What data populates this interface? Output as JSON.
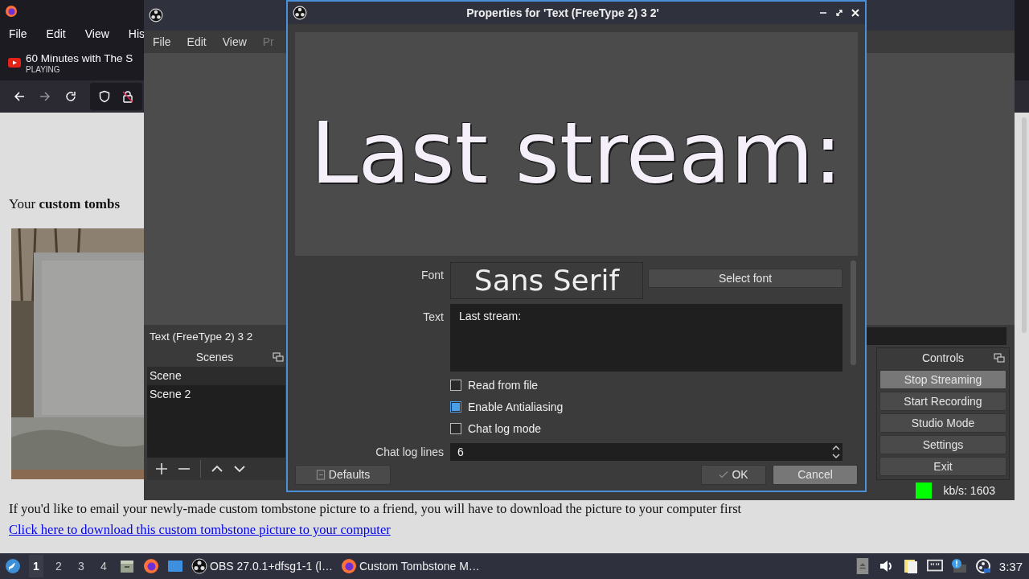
{
  "browser": {
    "menu": [
      "File",
      "Edit",
      "View",
      "His"
    ],
    "tab": {
      "title": "60 Minutes with The S",
      "status": "PLAYING"
    },
    "page": {
      "heading": "Your **custom tombs**",
      "paragraph": "If you'd like to email your newly-made custom tombstone picture to a friend, you will have to download the picture to your computer first",
      "link": "Click here to download this custom tombstone picture to your computer"
    }
  },
  "obs": {
    "menu": [
      {
        "label": "File",
        "disabled": false
      },
      {
        "label": "Edit",
        "disabled": false
      },
      {
        "label": "View",
        "disabled": false
      },
      {
        "label": "Pr",
        "disabled": true
      }
    ],
    "source_name": "Text (FreeType 2) 3 2",
    "scenes": {
      "title": "Scenes",
      "items": [
        {
          "label": "Scene",
          "selected": true
        },
        {
          "label": "Scene 2",
          "selected": false
        }
      ]
    },
    "controls": {
      "title": "Controls",
      "buttons": [
        {
          "label": "Stop Streaming",
          "active": true
        },
        {
          "label": "Start Recording",
          "active": false
        },
        {
          "label": "Studio Mode",
          "active": false
        },
        {
          "label": "Settings",
          "active": false
        },
        {
          "label": "Exit",
          "active": false
        }
      ]
    },
    "status": {
      "bitrate": "kb/s: 1603"
    }
  },
  "dialog": {
    "title": "Properties for 'Text (FreeType 2) 3 2'",
    "preview_text": "Last stream:",
    "font": {
      "label": "Font",
      "preview": "Sans Serif",
      "button": "Select font"
    },
    "text": {
      "label": "Text",
      "value": "Last stream:"
    },
    "options": [
      {
        "label": "Read from file",
        "checked": false
      },
      {
        "label": "Enable Antialiasing",
        "checked": true
      },
      {
        "label": "Chat log mode",
        "checked": false
      }
    ],
    "chat_log_lines": {
      "label": "Chat log lines",
      "value": "6"
    },
    "buttons": {
      "defaults": "Defaults",
      "ok": "OK",
      "cancel": "Cancel"
    }
  },
  "taskbar": {
    "workspaces": [
      {
        "label": "1",
        "selected": true
      },
      {
        "label": "2",
        "selected": false
      },
      {
        "label": "3",
        "selected": false
      },
      {
        "label": "4",
        "selected": false
      }
    ],
    "tasks": [
      "OBS 27.0.1+dfsg1-1 (l…",
      "Custom Tombstone M…"
    ],
    "clock": "3:37"
  }
}
